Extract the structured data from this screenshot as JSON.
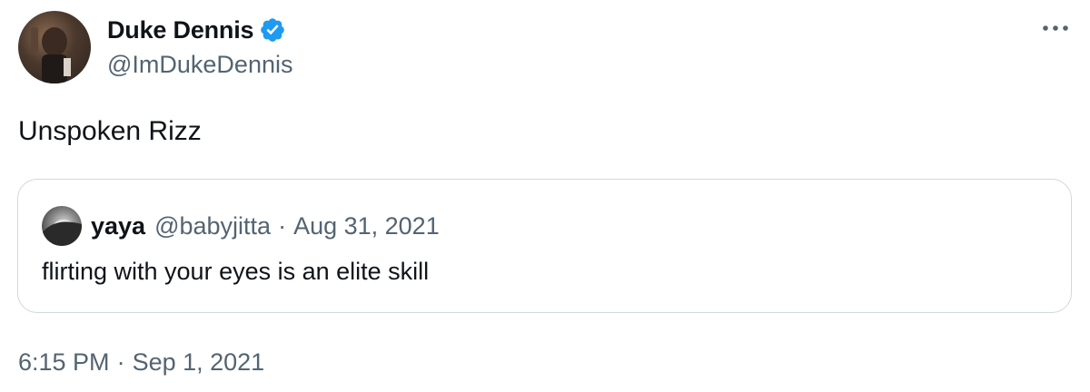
{
  "author": {
    "display_name": "Duke Dennis",
    "handle": "@ImDukeDennis",
    "verified": true,
    "verified_color": "#1d9bf0"
  },
  "tweet": {
    "text": "Unspoken Rizz"
  },
  "quoted_tweet": {
    "display_name": "yaya",
    "handle": "@babyjitta",
    "separator": "·",
    "date": "Aug 31, 2021",
    "text": "flirting with your eyes is an elite skill"
  },
  "meta": {
    "time": "6:15 PM",
    "separator": "·",
    "date": "Sep 1, 2021"
  },
  "icons": {
    "more": "more-horizontal-icon",
    "verified": "verified-badge-icon"
  },
  "colors": {
    "text_primary": "#0f1419",
    "text_secondary": "#536471",
    "border": "#cfd9de"
  }
}
